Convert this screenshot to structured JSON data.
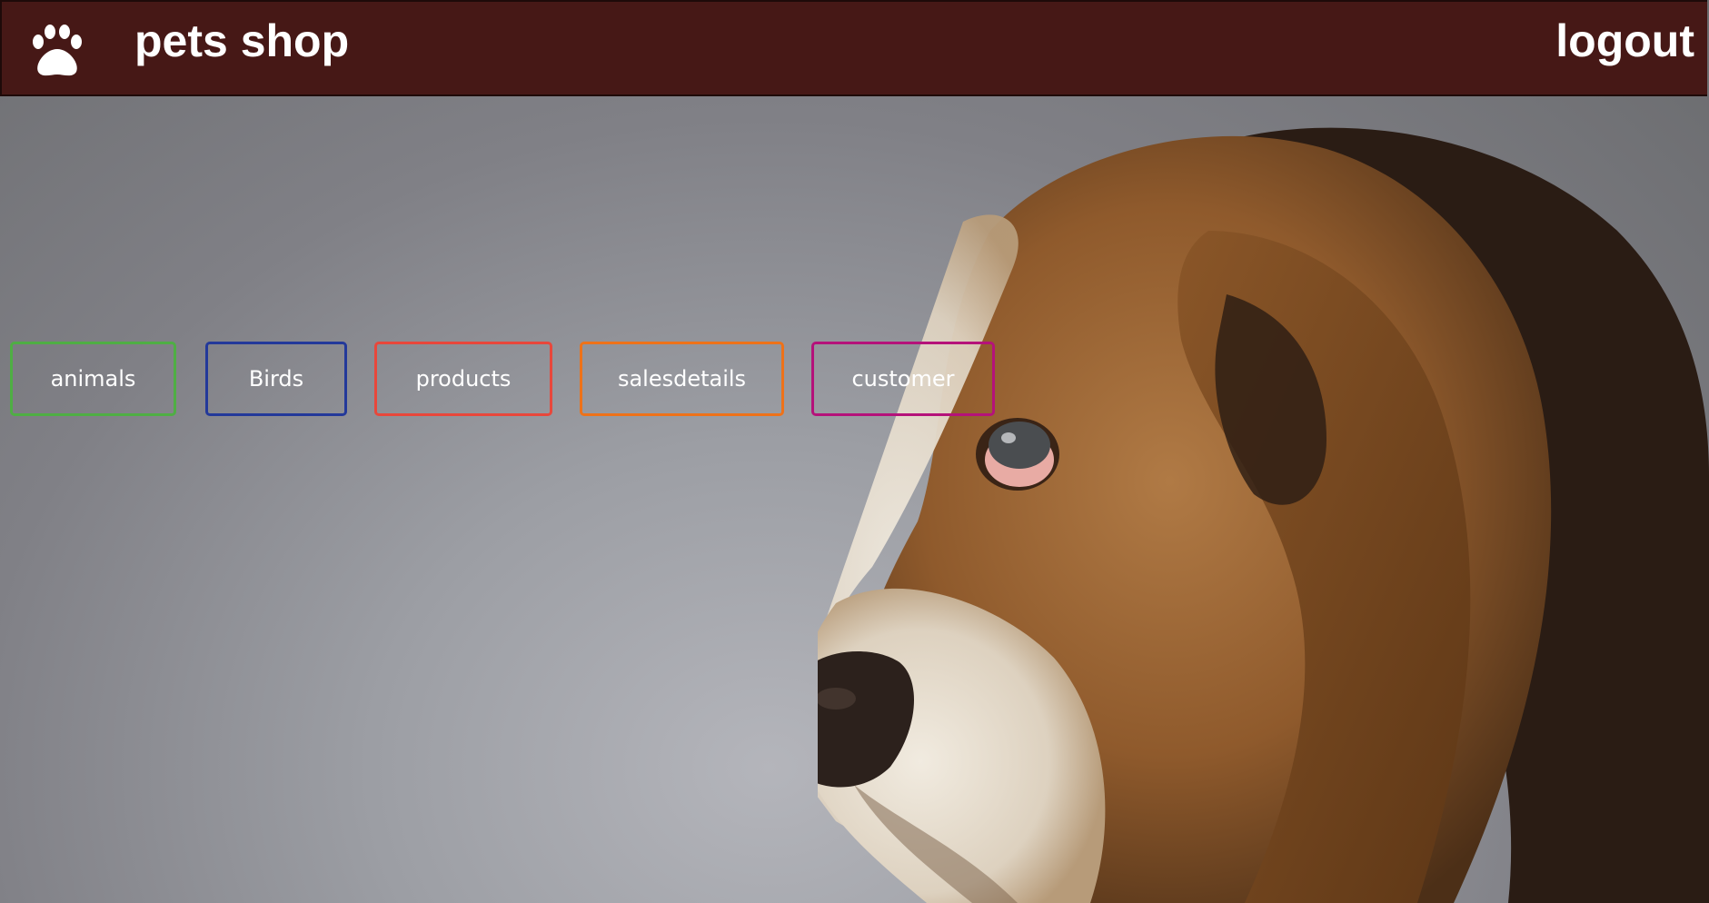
{
  "header": {
    "brand_icon": "paw-icon",
    "brand_title": "pets shop",
    "logout_label": "logout",
    "background_color": "#461816"
  },
  "nav": {
    "items": [
      {
        "label": "animals",
        "border_color": "#4fae44"
      },
      {
        "label": "Birds",
        "border_color": "#23399a"
      },
      {
        "label": "products",
        "border_color": "#e8473b"
      },
      {
        "label": "salesdetails",
        "border_color": "#ee7219"
      },
      {
        "label": "customer",
        "border_color": "#b5127a"
      }
    ]
  },
  "hero": {
    "image": "basset-hound-photo"
  }
}
